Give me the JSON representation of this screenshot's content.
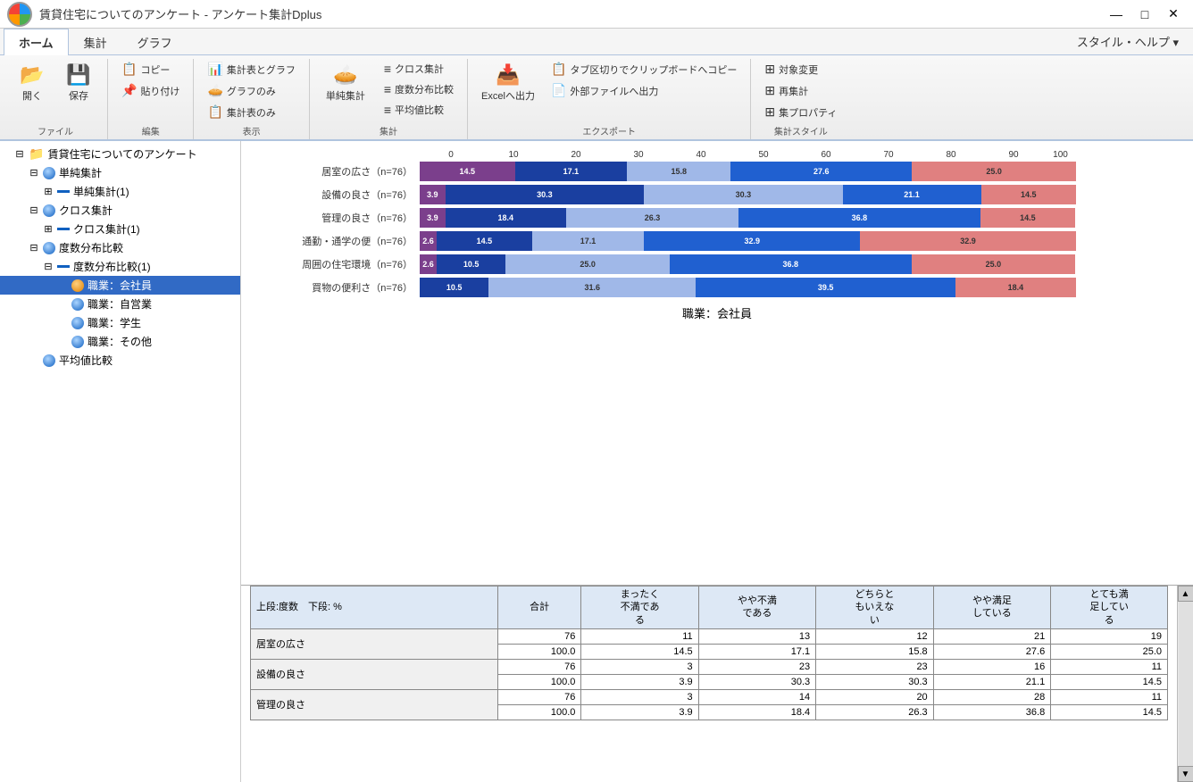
{
  "titleBar": {
    "title": "賃貸住宅についてのアンケート - アンケート集計Dplus",
    "controls": [
      "—",
      "□",
      "✕"
    ]
  },
  "ribbon": {
    "tabs": [
      "ホーム",
      "集計",
      "グラフ"
    ],
    "activeTab": "ホーム",
    "styleHelp": "スタイル・ヘルプ ▾",
    "groups": [
      {
        "label": "ファイル",
        "buttons": [
          {
            "icon": "📂",
            "label": "開く"
          },
          {
            "icon": "💾",
            "label": "保存"
          }
        ],
        "smallButtons": []
      },
      {
        "label": "編集",
        "buttons": [],
        "smallButtons": [
          {
            "icon": "📋",
            "label": "コピー"
          },
          {
            "icon": "📌",
            "label": "貼り付け"
          }
        ]
      },
      {
        "label": "表示",
        "buttons": [],
        "smallButtons": [
          {
            "icon": "📊",
            "label": "集計表とグラフ"
          },
          {
            "icon": "🥧",
            "label": "グラフのみ"
          },
          {
            "icon": "📋",
            "label": "集計表のみ"
          }
        ]
      },
      {
        "label": "集計",
        "bigButton": {
          "icon": "🥧",
          "label": "単純集計"
        },
        "smallButtons": [
          {
            "icon": "≡",
            "label": "クロス集計"
          },
          {
            "icon": "≡",
            "label": "度数分布比較"
          },
          {
            "icon": "≡",
            "label": "平均値比較"
          }
        ]
      },
      {
        "label": "エクスポート",
        "buttons": [
          {
            "icon": "📥",
            "label": "Excelへ出力"
          }
        ],
        "smallButtons": [
          {
            "icon": "📋",
            "label": "タブ区切りでクリップボードへコピー"
          },
          {
            "icon": "📄",
            "label": "外部ファイルへ出力"
          }
        ]
      },
      {
        "label": "集計スタイル",
        "buttons": [
          {
            "icon": "⊞",
            "label": "対象変更"
          },
          {
            "icon": "⊞",
            "label": "再集計"
          },
          {
            "icon": "⊞",
            "label": "集プロパティ"
          }
        ]
      }
    ]
  },
  "tree": {
    "items": [
      {
        "level": 0,
        "type": "folder",
        "label": "賃貸住宅についてのアンケート",
        "expanded": true
      },
      {
        "level": 1,
        "type": "ball-blue",
        "label": "単純集計",
        "expanded": true
      },
      {
        "level": 2,
        "type": "dash",
        "label": "単純集計(1)",
        "expandable": true
      },
      {
        "level": 1,
        "type": "ball-blue",
        "label": "クロス集計",
        "expanded": true
      },
      {
        "level": 2,
        "type": "dash",
        "label": "クロス集計(1)",
        "expandable": true
      },
      {
        "level": 1,
        "type": "ball-blue",
        "label": "度数分布比較",
        "expanded": true
      },
      {
        "level": 2,
        "type": "dash-expand",
        "label": "度数分布比較(1)",
        "expanded": true
      },
      {
        "level": 3,
        "type": "ball-orange",
        "label": "職業：会社員",
        "selected": true
      },
      {
        "level": 3,
        "type": "ball-blue",
        "label": "職業：自営業"
      },
      {
        "level": 3,
        "type": "ball-blue",
        "label": "職業：学生"
      },
      {
        "level": 3,
        "type": "ball-blue",
        "label": "職業：その他"
      },
      {
        "level": 1,
        "type": "ball-blue",
        "label": "平均値比較"
      }
    ]
  },
  "chart": {
    "title": "職業：会社員",
    "axisLabels": [
      "0",
      "10",
      "20",
      "30",
      "40",
      "50",
      "60",
      "70",
      "80",
      "90",
      "100"
    ],
    "rows": [
      {
        "label": "居室の広さ（n=76）",
        "segments": [
          {
            "pct": 14.5,
            "label": "14.5",
            "color": "purple"
          },
          {
            "pct": 17.1,
            "label": "17.1",
            "color": "darkblue"
          },
          {
            "pct": 15.8,
            "label": "15.8",
            "color": "lightblue"
          },
          {
            "pct": 27.6,
            "label": "27.6",
            "color": "blue"
          },
          {
            "pct": 25.0,
            "label": "25.0",
            "color": "salmon"
          }
        ]
      },
      {
        "label": "設備の良さ（n=76）",
        "segments": [
          {
            "pct": 3.9,
            "label": "3.9",
            "color": "purple"
          },
          {
            "pct": 30.3,
            "label": "30.3",
            "color": "darkblue"
          },
          {
            "pct": 30.3,
            "label": "30.3",
            "color": "lightblue"
          },
          {
            "pct": 21.1,
            "label": "21.1",
            "color": "blue"
          },
          {
            "pct": 14.5,
            "label": "14.5",
            "color": "salmon"
          }
        ]
      },
      {
        "label": "管理の良さ（n=76）",
        "segments": [
          {
            "pct": 3.9,
            "label": "3.9",
            "color": "purple"
          },
          {
            "pct": 18.4,
            "label": "18.4",
            "color": "darkblue"
          },
          {
            "pct": 26.3,
            "label": "26.3",
            "color": "lightblue"
          },
          {
            "pct": 36.8,
            "label": "36.8",
            "color": "blue"
          },
          {
            "pct": 14.5,
            "label": "14.5",
            "color": "salmon"
          }
        ]
      },
      {
        "label": "通勤・通学の便（n=76）",
        "segments": [
          {
            "pct": 2.6,
            "label": "2.6",
            "color": "purple"
          },
          {
            "pct": 14.5,
            "label": "14.5",
            "color": "darkblue"
          },
          {
            "pct": 17.1,
            "label": "17.1",
            "color": "lightblue"
          },
          {
            "pct": 32.9,
            "label": "32.9",
            "color": "blue"
          },
          {
            "pct": 32.9,
            "label": "32.9",
            "color": "salmon"
          }
        ]
      },
      {
        "label": "周囲の住宅環境（n=76）",
        "segments": [
          {
            "pct": 2.6,
            "label": "2.6",
            "color": "purple"
          },
          {
            "pct": 10.5,
            "label": "10.5",
            "color": "darkblue"
          },
          {
            "pct": 25.0,
            "label": "25.0",
            "color": "lightblue"
          },
          {
            "pct": 36.8,
            "label": "36.8",
            "color": "blue"
          },
          {
            "pct": 25.0,
            "label": "25.0",
            "color": "salmon"
          }
        ]
      },
      {
        "label": "買物の便利さ（n=76）",
        "segments": [
          {
            "pct": 0,
            "label": "",
            "color": "purple"
          },
          {
            "pct": 10.5,
            "label": "10.5",
            "color": "darkblue"
          },
          {
            "pct": 31.6,
            "label": "31.6",
            "color": "lightblue"
          },
          {
            "pct": 39.5,
            "label": "39.5",
            "color": "blue"
          },
          {
            "pct": 18.4,
            "label": "18.4",
            "color": "salmon"
          }
        ]
      }
    ]
  },
  "table": {
    "header": {
      "rowLabel": "上段:度数　下段: %",
      "columns": [
        "合計",
        "まったく\n不満であ\nる",
        "やや不満\nである",
        "どちらと\nもいえな\nい",
        "やや満足\nしている",
        "とても満\n足してい\nる"
      ]
    },
    "rows": [
      {
        "label": "居室の広さ",
        "values1": [
          "76",
          "11",
          "13",
          "12",
          "21",
          "19"
        ],
        "values2": [
          "100.0",
          "14.5",
          "17.1",
          "15.8",
          "27.6",
          "25.0"
        ]
      },
      {
        "label": "設備の良さ",
        "values1": [
          "76",
          "3",
          "23",
          "23",
          "16",
          "11"
        ],
        "values2": [
          "100.0",
          "3.9",
          "30.3",
          "30.3",
          "21.1",
          "14.5"
        ]
      },
      {
        "label": "管理の良さ",
        "values1": [
          "76",
          "3",
          "14",
          "20",
          "28",
          "11"
        ],
        "values2": [
          "100.0",
          "3.9",
          "18.4",
          "26.3",
          "36.8",
          "14.5"
        ]
      }
    ]
  }
}
